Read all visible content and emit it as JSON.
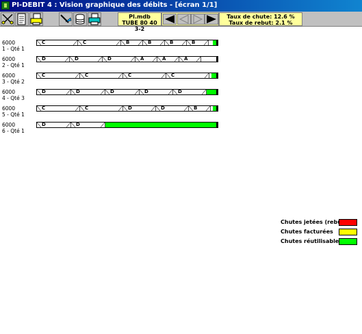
{
  "window": {
    "title": "PI-DEBIT 4 : Vision graphique des débits - [écran 1/1]"
  },
  "toolbar": {
    "buttons": [
      {
        "name": "scissors-icon"
      },
      {
        "name": "document-icon"
      },
      {
        "name": "print-preview-icon"
      },
      {
        "name": "saw-cut-icon"
      },
      {
        "name": "stack-icon"
      },
      {
        "name": "printer-icon"
      }
    ],
    "file_name": "PI.mdb",
    "profile": "TUBE 80 40 3-2",
    "drop_rate_label": "Taux de chute: 12.6 %",
    "reject_rate_label": "Taux de rebut: 2.1 %"
  },
  "bars": [
    {
      "length": "6000",
      "label": "1 - Qté 1",
      "pieces": [
        {
          "code": "C",
          "w": 60
        },
        {
          "code": "C",
          "w": 63
        },
        {
          "code": "B",
          "w": 32
        },
        {
          "code": "B",
          "w": 32
        },
        {
          "code": "B",
          "w": 32
        },
        {
          "code": "B",
          "w": 32
        }
      ],
      "scrap": 5
    },
    {
      "length": "6000",
      "label": "2 - Qté 1",
      "pieces": [
        {
          "code": "D",
          "w": 48
        },
        {
          "code": "D",
          "w": 48
        },
        {
          "code": "D",
          "w": 48
        },
        {
          "code": "A",
          "w": 32
        },
        {
          "code": "A",
          "w": 32
        },
        {
          "code": "A",
          "w": 32
        }
      ],
      "scrap": 0
    },
    {
      "length": "6000",
      "label": "3 - Qté 2",
      "pieces": [
        {
          "code": "C",
          "w": 63
        },
        {
          "code": "C",
          "w": 63
        },
        {
          "code": "C",
          "w": 63
        },
        {
          "code": "C",
          "w": 63
        }
      ],
      "scrap": 7
    },
    {
      "length": "6000",
      "label": "4 - Qté 3",
      "pieces": [
        {
          "code": "D",
          "w": 50
        },
        {
          "code": "D",
          "w": 50
        },
        {
          "code": "D",
          "w": 50
        },
        {
          "code": "D",
          "w": 49
        },
        {
          "code": "D",
          "w": 49
        }
      ],
      "scrap": 14
    },
    {
      "length": "6000",
      "label": "5 - Qté 1",
      "pieces": [
        {
          "code": "C",
          "w": 63
        },
        {
          "code": "C",
          "w": 63
        },
        {
          "code": "D",
          "w": 48
        },
        {
          "code": "D",
          "w": 48
        },
        {
          "code": "B",
          "w": 32
        }
      ],
      "scrap": 5
    },
    {
      "length": "6000",
      "label": "6 - Qté 1",
      "pieces": [
        {
          "code": "D",
          "w": 50
        },
        {
          "code": "D",
          "w": 50
        }
      ],
      "scrap": 162
    }
  ],
  "legend": [
    {
      "label": "Chutes jetées (rebut)",
      "color": "#ff0000"
    },
    {
      "label": "Chutes facturées",
      "color": "#ffff00"
    },
    {
      "label": "Chutes réutilisables",
      "color": "#00ff00"
    }
  ]
}
